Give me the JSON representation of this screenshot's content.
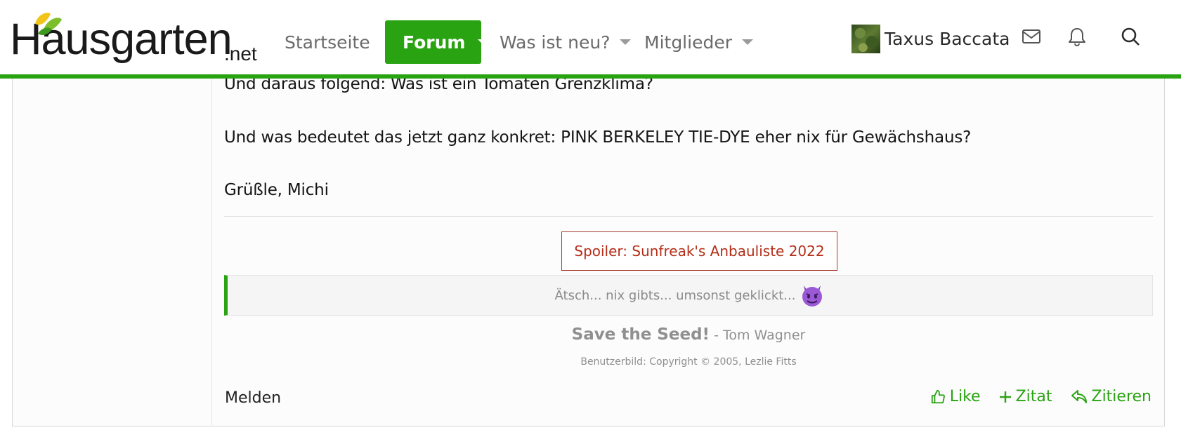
{
  "site": {
    "logo_main": "Hausgarten",
    "logo_suffix": ".net"
  },
  "nav": {
    "home": "Startseite",
    "forum": "Forum",
    "whats_new": "Was ist neu?",
    "members": "Mitglieder"
  },
  "user": {
    "name": "Taxus Baccata"
  },
  "post": {
    "lines": [
      "Und daraus folgend: Was ist ein Tomaten Grenzklima?",
      "Und was bedeutet das jetzt ganz konkret: PINK BERKELEY TIE-DYE eher nix für Gewächshaus?",
      "Grüßle, Michi"
    ],
    "spoiler_label": "Spoiler: Sunfreak's Anbauliste 2022",
    "quote_text": "Ätsch... nix gibts... umsonst geklickt...",
    "quote_emoji": "smiling-devil-icon",
    "signature_main": "Save the Seed!",
    "signature_author": " - Tom Wagner",
    "signature_copyright": "Benutzerbild: Copyright © 2005, Lezlie Fitts",
    "report_label": "Melden",
    "like_label": "Like",
    "quote_label": "Zitat",
    "reply_label": "Zitieren"
  },
  "colors": {
    "accent": "#2aa313",
    "spoiler": "#b32d17"
  }
}
